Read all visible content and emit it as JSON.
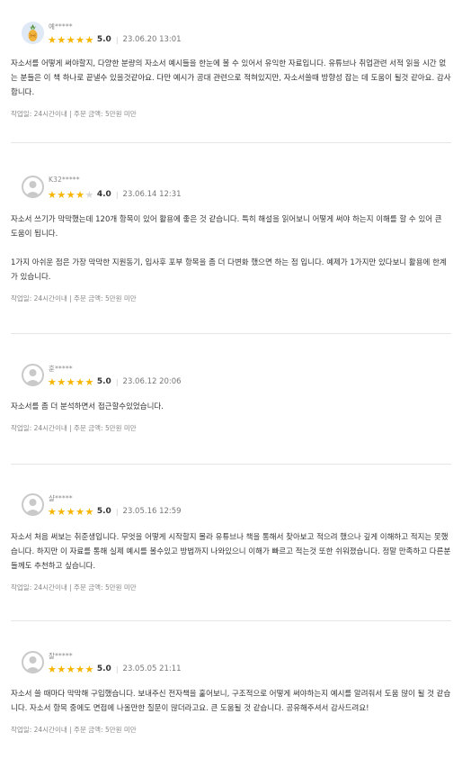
{
  "reviews": [
    {
      "name": "예*****",
      "rating": 5,
      "score": "5.0",
      "date": "23.06.20 13:01",
      "avatar": "pineapple-avatar",
      "paragraphs": [
        "자소서를 어떻게 써야할지, 다양한 분량의 자소서 예시들을 한눈에 볼 수 있어서 유익한 자료입니다. 유튜브나 취업관련 서적 읽을 시간 없는 분들은 이 책 하나로 끝낼수 있을것같아요. 다만 예시가 공대 관련으로 적혀있지만, 자소서쓸때 방향성 잡는 데 도움이 될것 같아요. 감사합니다."
      ],
      "footer": "작업일: 24시간이내 | 주문 금액: 5만원 미만"
    },
    {
      "name": "K32*****",
      "rating": 4,
      "score": "4.0",
      "date": "23.06.14 12:31",
      "avatar": "default-avatar",
      "paragraphs": [
        "자소서 쓰기가 막막했는데 120개 항목이 있어 활용에 좋은 것 같습니다. 특히 해설을 읽어보니 어떻게 써야 하는지 이해를 할 수 있어 큰 도움이 됩니다.",
        "1가지 아쉬운 점은 가장 막막한 지원동기, 입사후 포부 항목을 좀 더 다변화 했으면 하는 점 입니다. 예제가 1가지만 있다보니 활용에 한계가 있습니다."
      ],
      "footer": "작업일: 24시간이내 | 주문 금액: 5만원 미만"
    },
    {
      "name": "훈*****",
      "rating": 5,
      "score": "5.0",
      "date": "23.06.12 20:06",
      "avatar": "default-avatar",
      "paragraphs": [
        "자소서를 좀 더 분석하면서 접근할수있었습니다."
      ],
      "footer": "작업일: 24시간이내 | 주문 금액: 5만원 미만"
    },
    {
      "name": "샬*****",
      "rating": 5,
      "score": "5.0",
      "date": "23.05.16 12:59",
      "avatar": "default-avatar",
      "paragraphs": [
        "자소서 처음 써보는 취준생입니다. 무엇을 어떻게 시작할지 몰라 유튜브나 책을 통해서 찾아보고 적으려 했으나 깊게 이해하고 적지는 못했습니다. 하지만 이 자료를 통해 실제 예시를 볼수있고 방법까지 나와있으니 이해가 빠르고 적는것 또한 쉬워졌습니다. 정말 만족하고 다른분들께도 추천하고 싶습니다."
      ],
      "footer": "작업일: 24시간이내 | 주문 금액: 5만원 미만"
    },
    {
      "name": "잘*****",
      "rating": 5,
      "score": "5.0",
      "date": "23.05.05 21:11",
      "avatar": "default-avatar",
      "paragraphs": [
        "자소서 쓸 때마다 막막해 구입했습니다. 보내주신 전자책을 훑어보니, 구조적으로 어떻게 써야하는지 예시를 알려줘서 도움 많이 될 것 같습니다. 자소서 항목 중에도 면접에 나올만한 질문이 많더라고요. 큰 도움될 것 같습니다. 공유해주셔서 감사드려요!"
      ],
      "footer": "작업일: 24시간이내 | 주문 금액: 5만원 미만"
    }
  ],
  "colors": {
    "star_on": "#f7b500",
    "star_off": "#d9d9d9",
    "divider": "#e6e6e6"
  }
}
